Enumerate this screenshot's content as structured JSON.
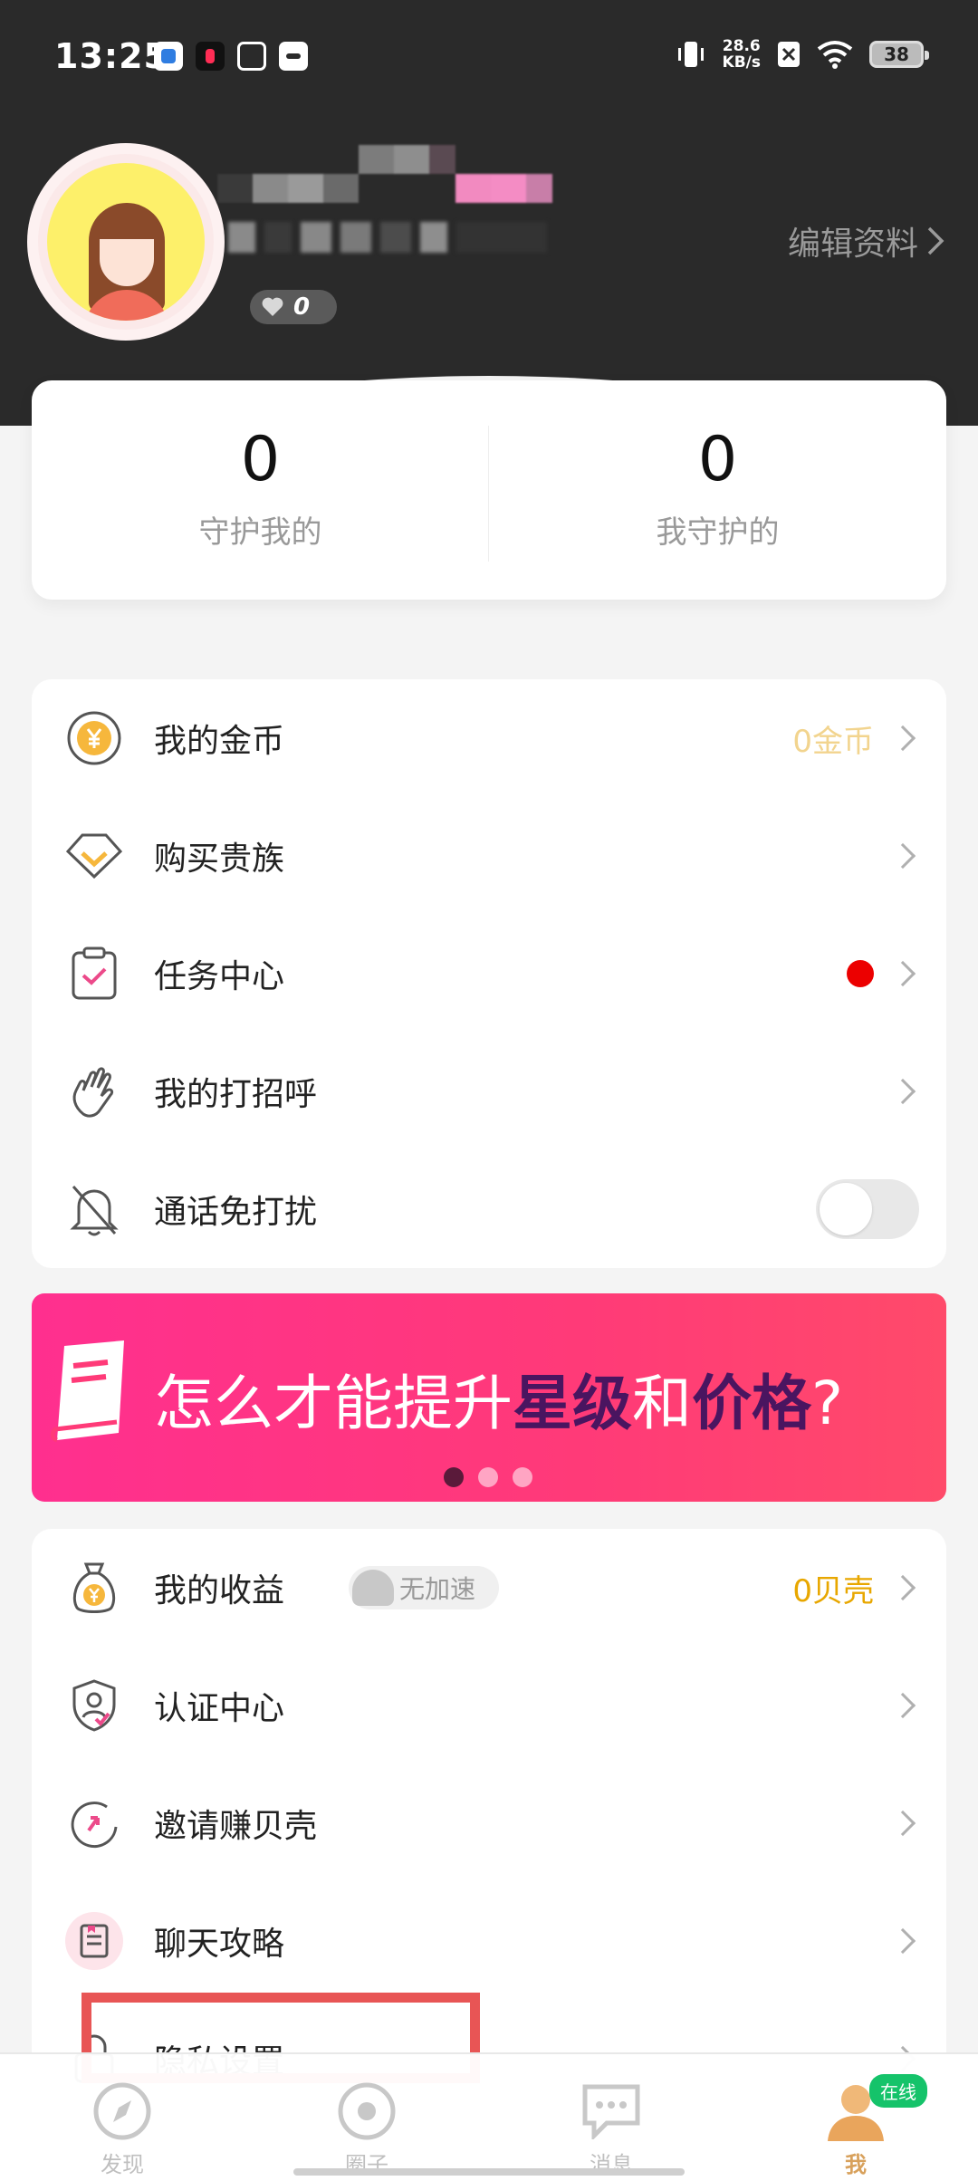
{
  "status_bar": {
    "time": "13:25",
    "net_speed_value": "28.6",
    "net_speed_unit": "KB/s",
    "battery": "38"
  },
  "profile": {
    "likes_count": "0",
    "edit_label": "编辑资料"
  },
  "stats": [
    {
      "value": "0",
      "label": "守护我的"
    },
    {
      "value": "0",
      "label": "我守护的"
    }
  ],
  "menu_primary": [
    {
      "label": "我的金币",
      "icon": "coin-icon",
      "right_text": "0金币"
    },
    {
      "label": "购买贵族",
      "icon": "diamond-icon"
    },
    {
      "label": "任务中心",
      "icon": "clipboard-icon",
      "has_red_dot": true
    },
    {
      "label": "我的打招呼",
      "icon": "wave-hand-icon"
    },
    {
      "label": "通话免打扰",
      "icon": "bell-off-icon",
      "toggle_on": false
    }
  ],
  "banner": {
    "text_plain_1": "怎么才能提升",
    "text_em_1": "星级",
    "text_plain_2": "和",
    "text_em_2": "价格",
    "text_plain_3": "?",
    "page_count": 3,
    "active_page": 0
  },
  "menu_secondary": [
    {
      "label": "我的收益",
      "icon": "money-bag-icon",
      "badge": "无加速",
      "right_text": "0贝壳"
    },
    {
      "label": "认证中心",
      "icon": "shield-check-icon"
    },
    {
      "label": "邀请赚贝壳",
      "icon": "refresh-share-icon"
    },
    {
      "label": "聊天攻略",
      "icon": "chat-guide-icon"
    },
    {
      "label": "隐私设置",
      "icon": "lock-icon"
    }
  ],
  "bottom_nav": [
    {
      "label": "发现",
      "icon": "compass-icon",
      "active": false
    },
    {
      "label": "圈子",
      "icon": "circle-icon",
      "active": false
    },
    {
      "label": "消息",
      "icon": "message-icon",
      "active": false
    },
    {
      "label": "我",
      "icon": "profile-icon",
      "active": true,
      "badge": "在线"
    }
  ],
  "colors": {
    "header_bg": "#2a2a2a",
    "gold_text": "#e8a700",
    "banner_pink": "#ff3a78",
    "online_green": "#15c36a",
    "active_nav": "#d8a15c"
  }
}
